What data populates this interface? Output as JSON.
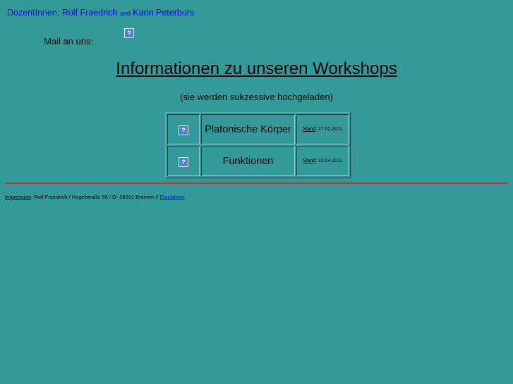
{
  "header": {
    "prefix": "DozentInnen: Rolf Fraedrich",
    "und": "und",
    "name2": "Karin Peterburs"
  },
  "mail": {
    "label": "Mail an uns:",
    "icon": "broken-image-icon"
  },
  "title": "Informationen zu unseren Workshops",
  "subtitle": "(sie werden sukzessive hochgeladen)",
  "workshops": [
    {
      "name": "Platonische Körper",
      "stand_label": "Stand",
      "stand_date": ": 27.02.2011",
      "icon": "broken-image-icon"
    },
    {
      "name": "Funktionen",
      "stand_label": "Stand",
      "stand_date": ": 15.04.2011",
      "icon": "broken-image-icon"
    }
  ],
  "footer": {
    "impressum": "Impressum",
    "address": ": Rolf Fraedrich / Hegelstraße 55 / D- 28201 Bremen // ",
    "disclaimer": "Disclaimer"
  },
  "colors": {
    "background": "#339999",
    "link": "#0000ee",
    "rule": "#cc3333"
  }
}
